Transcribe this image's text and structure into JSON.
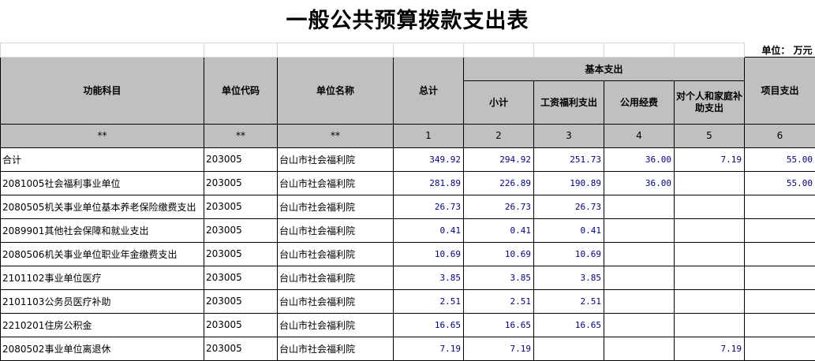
{
  "title": "一般公共预算拨款支出表",
  "unit_label": "单位：  万元",
  "headers": {
    "func": "功能科目",
    "code": "单位代码",
    "name": "单位名称",
    "total": "总计",
    "basic": "基本支出",
    "subtotal": "小计",
    "salary": "工资福利支出",
    "public": "公用经费",
    "personal": "对个人和家庭补助支出",
    "project": "项目支出"
  },
  "index_row": [
    "**",
    "**",
    "**",
    "1",
    "2",
    "3",
    "4",
    "5",
    "6"
  ],
  "rows": [
    {
      "func": "合计",
      "code": "203005",
      "name": "台山市社会福利院",
      "total": "349.92",
      "subtotal": "294.92",
      "salary": "251.73",
      "public": "36.00",
      "personal": "7.19",
      "project": "55.00"
    },
    {
      "func": "2081005社会福利事业单位",
      "code": "203005",
      "name": "台山市社会福利院",
      "total": "281.89",
      "subtotal": "226.89",
      "salary": "190.89",
      "public": "36.00",
      "personal": "",
      "project": "55.00"
    },
    {
      "func": "2080505机关事业单位基本养老保险缴费支出",
      "code": "203005",
      "name": "台山市社会福利院",
      "total": "26.73",
      "subtotal": "26.73",
      "salary": "26.73",
      "public": "",
      "personal": "",
      "project": ""
    },
    {
      "func": "2089901其他社会保障和就业支出",
      "code": "203005",
      "name": "台山市社会福利院",
      "total": "0.41",
      "subtotal": "0.41",
      "salary": "0.41",
      "public": "",
      "personal": "",
      "project": ""
    },
    {
      "func": "2080506机关事业单位职业年金缴费支出",
      "code": "203005",
      "name": "台山市社会福利院",
      "total": "10.69",
      "subtotal": "10.69",
      "salary": "10.69",
      "public": "",
      "personal": "",
      "project": ""
    },
    {
      "func": "2101102事业单位医疗",
      "code": "203005",
      "name": "台山市社会福利院",
      "total": "3.85",
      "subtotal": "3.85",
      "salary": "3.85",
      "public": "",
      "personal": "",
      "project": ""
    },
    {
      "func": "2101103公务员医疗补助",
      "code": "203005",
      "name": "台山市社会福利院",
      "total": "2.51",
      "subtotal": "2.51",
      "salary": "2.51",
      "public": "",
      "personal": "",
      "project": ""
    },
    {
      "func": "2210201住房公积金",
      "code": "203005",
      "name": "台山市社会福利院",
      "total": "16.65",
      "subtotal": "16.65",
      "salary": "16.65",
      "public": "",
      "personal": "",
      "project": ""
    },
    {
      "func": "2080502事业单位离退休",
      "code": "203005",
      "name": "台山市社会福利院",
      "total": "7.19",
      "subtotal": "7.19",
      "salary": "",
      "public": "",
      "personal": "7.19",
      "project": ""
    }
  ]
}
